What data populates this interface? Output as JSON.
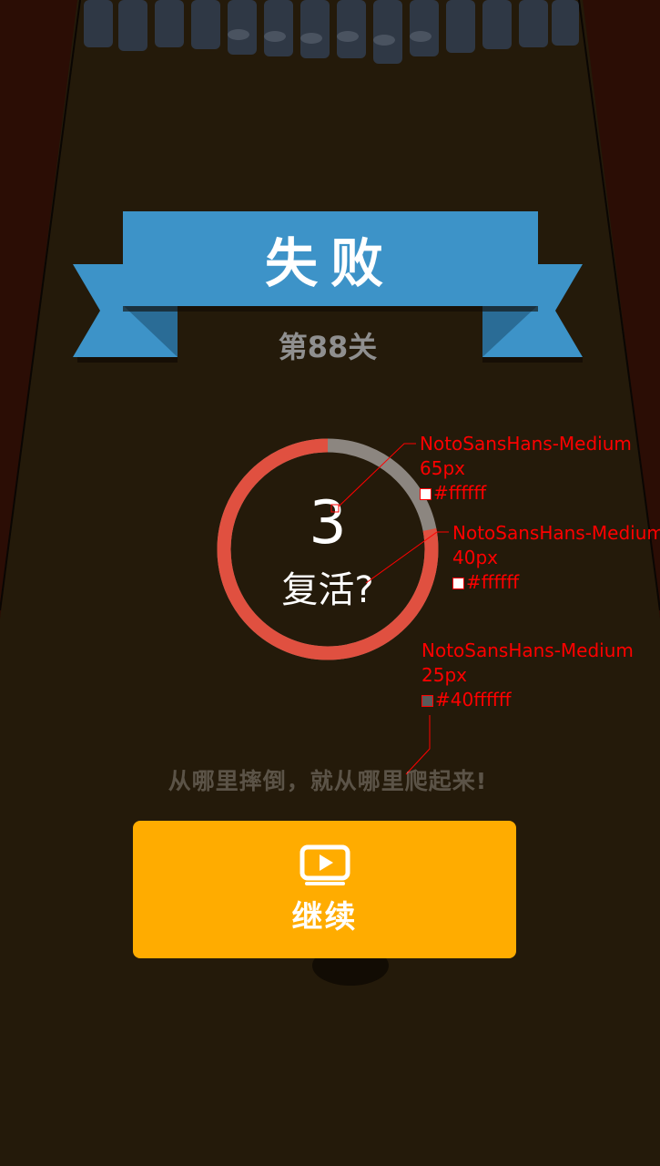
{
  "banner": {
    "title": "失败"
  },
  "level": {
    "label": "第88关"
  },
  "revive": {
    "countdown": "3",
    "prompt": "复活?",
    "progress_remaining": 0.78,
    "colors": {
      "active": "#e05040",
      "remaining": "#8c8680"
    }
  },
  "annotations": [
    {
      "font": "NotoSansHans-Medium",
      "size": "65px",
      "color": "#ffffff"
    },
    {
      "font": "NotoSansHans-Medium",
      "size": "40px",
      "color": "#ffffff"
    },
    {
      "font": "NotoSansHans-Medium",
      "size": "25px",
      "color": "#40ffffff"
    }
  ],
  "motto": "从哪里摔倒，就从哪里爬起来!",
  "continue_button": {
    "label": "继续",
    "icon": "video-play-icon",
    "color": "#ffac00"
  },
  "colors": {
    "banner": "#3d93c8",
    "banner_dark": "#2a6c96",
    "background": "#231808"
  }
}
